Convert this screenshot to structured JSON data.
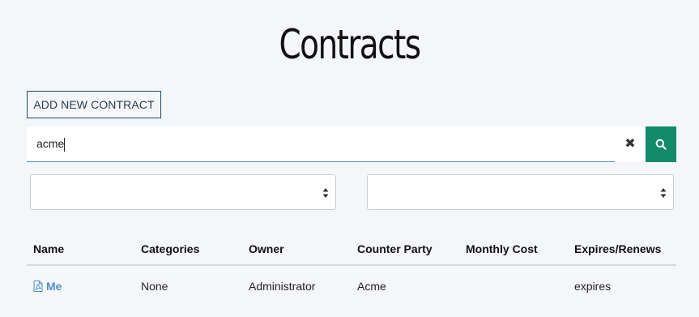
{
  "page": {
    "title": "Contracts"
  },
  "toolbar": {
    "add_label": "ADD NEW CONTRACT"
  },
  "search": {
    "value": "acme",
    "placeholder": ""
  },
  "icons": {
    "clear": "close-icon",
    "search": "search-icon",
    "file": "pdf-file-icon",
    "select_arrows": "chevron-updown-icon"
  },
  "colors": {
    "accent": "#138a6a",
    "link": "#4a90c8",
    "button_border": "#1d4a66",
    "background": "#f5f6fa"
  },
  "filters": [
    {
      "selected": ""
    },
    {
      "selected": ""
    }
  ],
  "table": {
    "columns": [
      "Name",
      "Categories",
      "Owner",
      "Counter Party",
      "Monthly Cost",
      "Expires/Renews"
    ],
    "rows": [
      {
        "name": "Me",
        "categories": "None",
        "owner": "Administrator",
        "counter_party": "Acme",
        "monthly_cost": "",
        "expires": "expires"
      }
    ]
  }
}
